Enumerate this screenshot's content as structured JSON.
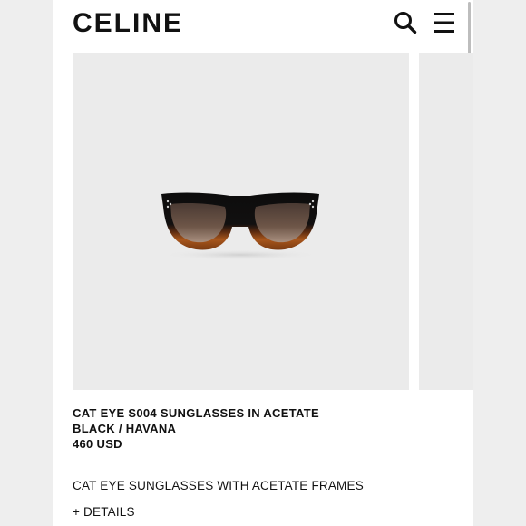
{
  "header": {
    "logo": "CELINE",
    "search_icon": "search-icon",
    "menu_icon": "hamburger-menu-icon"
  },
  "product": {
    "title": "CAT EYE S004 SUNGLASSES IN ACETATE",
    "variant": "BLACK / HAVANA",
    "price": "460 USD",
    "description": "CAT EYE SUNGLASSES WITH ACETATE FRAMES",
    "details_label": "+ DETAILS"
  },
  "colors": {
    "frame_black": "#111111",
    "havana": "#9a4a16",
    "lens_brown": "#6e5648",
    "image_bg": "#ebebeb"
  }
}
